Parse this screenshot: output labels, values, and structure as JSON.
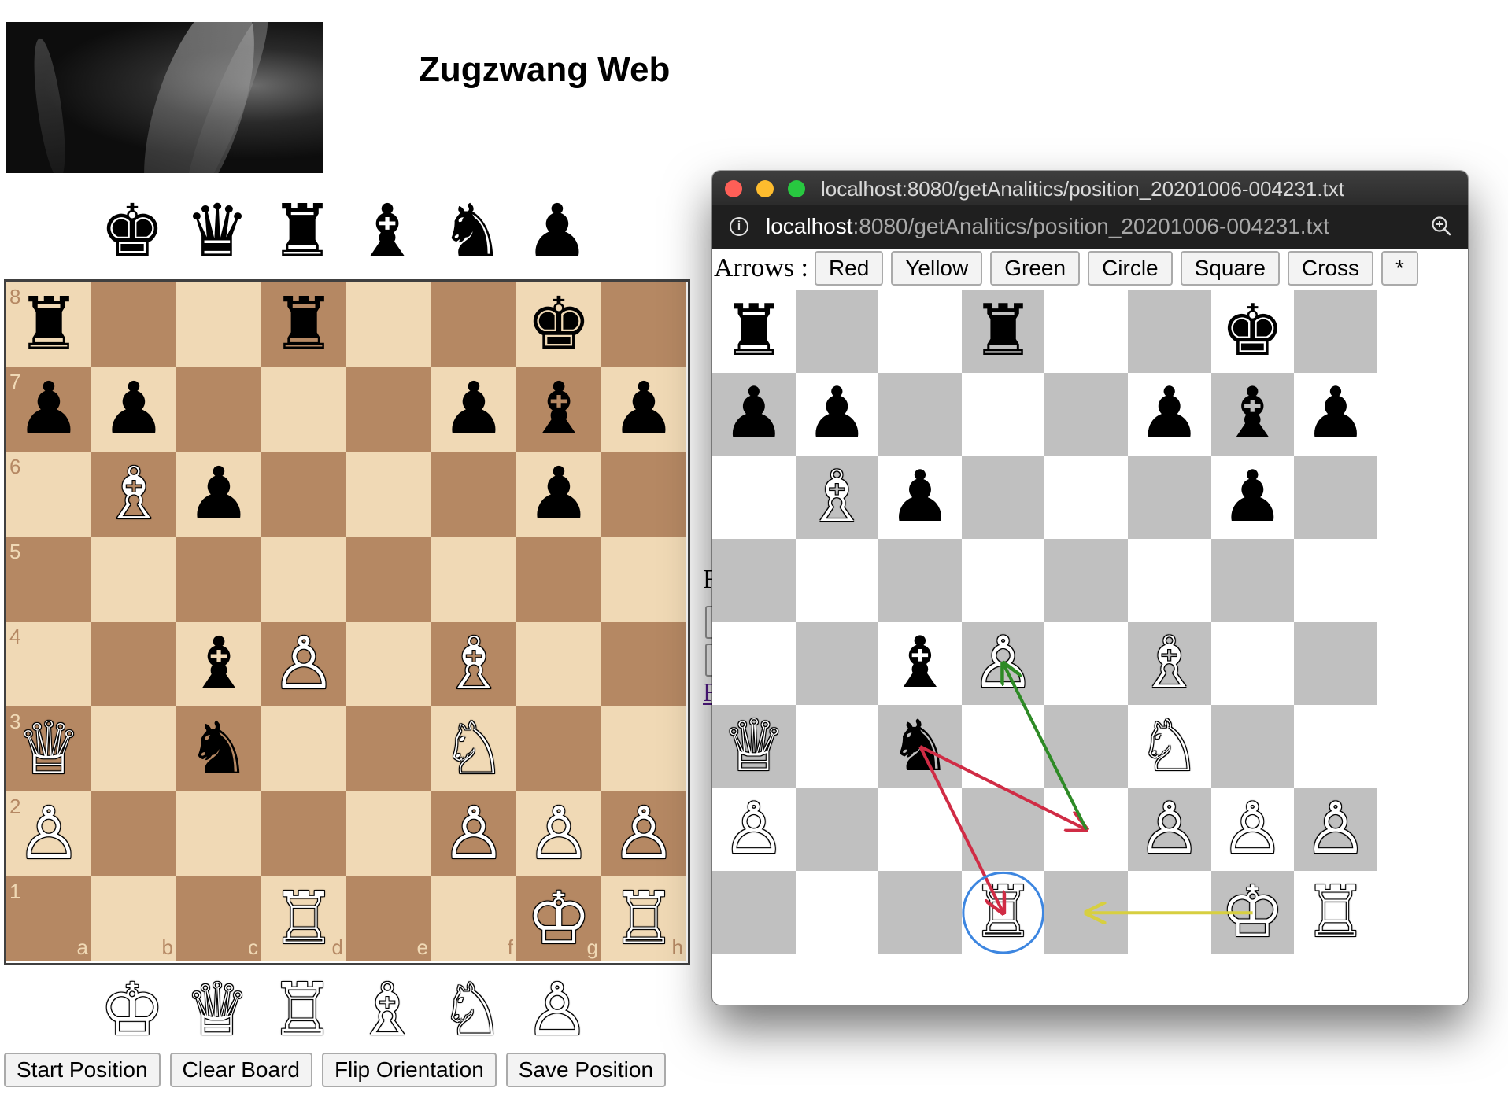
{
  "app": {
    "title": "Zugzwang Web"
  },
  "board": {
    "orientation": "white",
    "light_color": "#f0d9b5",
    "dark_color": "#b58863",
    "rank_labels": [
      "8",
      "7",
      "6",
      "5",
      "4",
      "3",
      "2",
      "1"
    ],
    "file_labels": [
      "a",
      "b",
      "c",
      "d",
      "e",
      "f",
      "g",
      "h"
    ],
    "rows": [
      [
        "bR",
        "",
        "",
        "bR",
        "",
        "",
        "bK",
        ""
      ],
      [
        "bP",
        "bP",
        "",
        "",
        "",
        "bP",
        "bB",
        "bP"
      ],
      [
        "",
        "wB",
        "bP",
        "",
        "",
        "",
        "bP",
        ""
      ],
      [
        "",
        "",
        "",
        "",
        "",
        "",
        "",
        ""
      ],
      [
        "",
        "",
        "bB",
        "wP",
        "",
        "wB",
        "",
        ""
      ],
      [
        "wQ",
        "",
        "bN",
        "",
        "",
        "wN",
        "",
        ""
      ],
      [
        "wP",
        "",
        "",
        "",
        "",
        "wP",
        "wP",
        "wP"
      ],
      [
        "",
        "",
        "",
        "wR",
        "",
        "",
        "wK",
        "wR"
      ]
    ]
  },
  "spare_pieces": {
    "black": [
      "bK",
      "bQ",
      "bR",
      "bB",
      "bN",
      "bP"
    ],
    "white": [
      "wK",
      "wQ",
      "wR",
      "wB",
      "wN",
      "wP"
    ]
  },
  "buttons": {
    "start": "Start Position",
    "clear": "Clear Board",
    "flip": "Flip Orientation",
    "save": "Save Position"
  },
  "glyphs": {
    "wK": "♔",
    "wQ": "♕",
    "wR": "♖",
    "wB": "♗",
    "wN": "♘",
    "wP": "♙",
    "bK": "♚",
    "bQ": "♛",
    "bR": "♜",
    "bB": "♝",
    "bN": "♞",
    "bP": "♟"
  },
  "background_page": {
    "partial_text_1": "F",
    "partial_link": "F"
  },
  "popup": {
    "window_title": "localhost:8080/getAnalitics/position_20201006-004231.txt",
    "url_host": "localhost",
    "url_rest": ":8080/getAnalitics/position_20201006-004231.txt",
    "traffic_lights": {
      "close": "#fe5f57",
      "minimize": "#febc2e",
      "zoom": "#28c840"
    },
    "toolbar": {
      "label": "Arrows :",
      "buttons": [
        "Red",
        "Yellow",
        "Green",
        "Circle",
        "Square",
        "Cross",
        "*"
      ]
    },
    "board": {
      "light_color": "#ffffff",
      "dark_color": "#c0c0c0"
    },
    "annotations": [
      {
        "type": "arrow",
        "color": "#d02c45",
        "from": "c3",
        "to": "d1"
      },
      {
        "type": "arrow",
        "color": "#d02c45",
        "from": "c3",
        "to": "e2"
      },
      {
        "type": "arrow",
        "color": "#2e8a26",
        "from": "e2",
        "to": "d4"
      },
      {
        "type": "arrow",
        "color": "#d7cf40",
        "from": "g1",
        "to": "e1"
      },
      {
        "type": "circle",
        "color": "#3d86e0",
        "square": "d1"
      }
    ]
  }
}
